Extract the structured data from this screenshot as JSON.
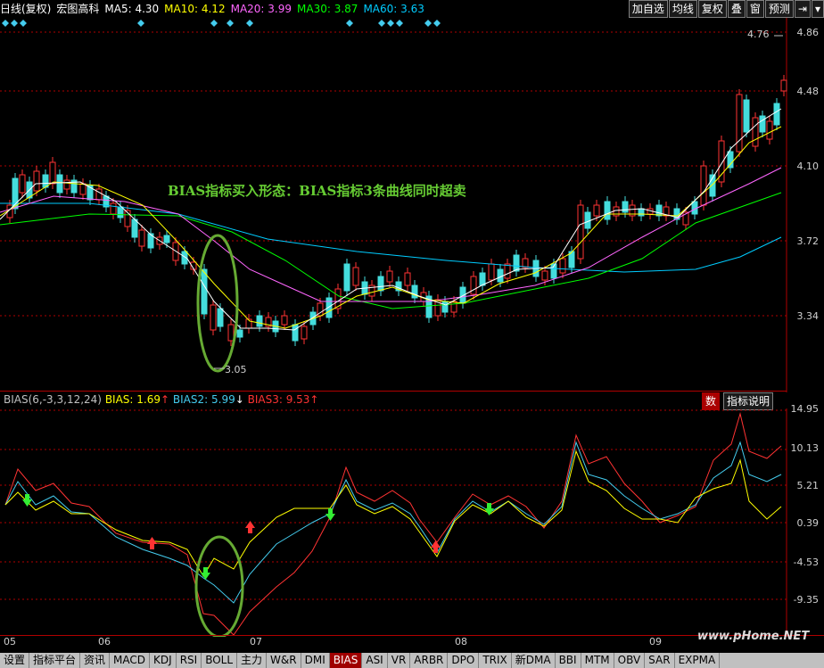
{
  "header": {
    "period": "日线(复权)",
    "stock_name": "宏图高科",
    "ma5": "MA5: 4.30",
    "ma10": "MA10: 4.12",
    "ma20": "MA20: 3.99",
    "ma30": "MA30: 3.87",
    "ma60": "MA60: 3.63",
    "colors": {
      "ma5": "#ffffff",
      "ma10": "#ffff00",
      "ma20": "#ff66ff",
      "ma30": "#00ff00",
      "ma60": "#00ccff"
    }
  },
  "toolbar": [
    "加自选",
    "均线",
    "复权",
    "叠",
    "窗",
    "预测"
  ],
  "price_axis": [
    "4.86",
    "4.48",
    "4.10",
    "3.72",
    "3.34"
  ],
  "price_marks": {
    "high": "4.76",
    "low": "3.05"
  },
  "annotation": "BIAS指标买入形态：BIAS指标3条曲线同时超卖",
  "indicator": {
    "title": "BIAS(6,-3,3,12,24)",
    "bias1": "BIAS: 1.69",
    "bias2": "BIAS2: 5.99",
    "bias3": "BIAS3: 9.53",
    "btn_num": "数",
    "btn_desc": "指标说明",
    "axis": [
      "14.95",
      "10.13",
      "5.21",
      "0.39",
      "-4.53",
      "-9.35"
    ]
  },
  "dates": [
    "05",
    "06",
    "07",
    "08",
    "09"
  ],
  "watermark": "www.pHome.NET",
  "tabs": [
    "设置",
    "指标平台",
    "资讯",
    "MACD",
    "KDJ",
    "RSI",
    "BOLL",
    "主力",
    "W&R",
    "DMI",
    "BIAS",
    "ASI",
    "VR",
    "ARBR",
    "DPO",
    "TRIX",
    "新DMA",
    "BBI",
    "MTM",
    "OBV",
    "SAR",
    "EXPMA"
  ],
  "active_tab": "BIAS"
}
